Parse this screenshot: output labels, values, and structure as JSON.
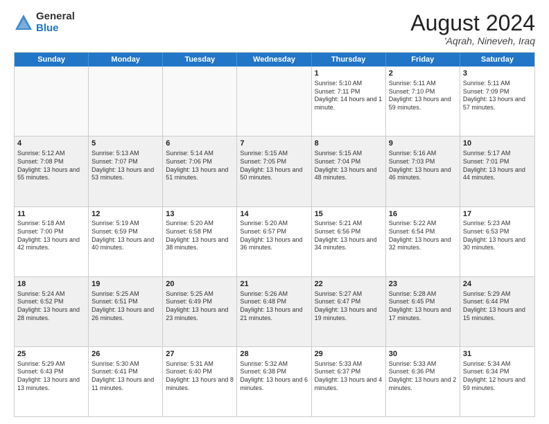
{
  "logo": {
    "general": "General",
    "blue": "Blue"
  },
  "title": {
    "month": "August 2024",
    "location": "'Aqrah, Nineveh, Iraq"
  },
  "header_days": [
    "Sunday",
    "Monday",
    "Tuesday",
    "Wednesday",
    "Thursday",
    "Friday",
    "Saturday"
  ],
  "rows": [
    [
      {
        "day": "",
        "info": "",
        "empty": true
      },
      {
        "day": "",
        "info": "",
        "empty": true
      },
      {
        "day": "",
        "info": "",
        "empty": true
      },
      {
        "day": "",
        "info": "",
        "empty": true
      },
      {
        "day": "1",
        "info": "Sunrise: 5:10 AM\nSunset: 7:11 PM\nDaylight: 14 hours and 1 minute."
      },
      {
        "day": "2",
        "info": "Sunrise: 5:11 AM\nSunset: 7:10 PM\nDaylight: 13 hours and 59 minutes."
      },
      {
        "day": "3",
        "info": "Sunrise: 5:11 AM\nSunset: 7:09 PM\nDaylight: 13 hours and 57 minutes."
      }
    ],
    [
      {
        "day": "4",
        "info": "Sunrise: 5:12 AM\nSunset: 7:08 PM\nDaylight: 13 hours and 55 minutes."
      },
      {
        "day": "5",
        "info": "Sunrise: 5:13 AM\nSunset: 7:07 PM\nDaylight: 13 hours and 53 minutes."
      },
      {
        "day": "6",
        "info": "Sunrise: 5:14 AM\nSunset: 7:06 PM\nDaylight: 13 hours and 51 minutes."
      },
      {
        "day": "7",
        "info": "Sunrise: 5:15 AM\nSunset: 7:05 PM\nDaylight: 13 hours and 50 minutes."
      },
      {
        "day": "8",
        "info": "Sunrise: 5:15 AM\nSunset: 7:04 PM\nDaylight: 13 hours and 48 minutes."
      },
      {
        "day": "9",
        "info": "Sunrise: 5:16 AM\nSunset: 7:03 PM\nDaylight: 13 hours and 46 minutes."
      },
      {
        "day": "10",
        "info": "Sunrise: 5:17 AM\nSunset: 7:01 PM\nDaylight: 13 hours and 44 minutes."
      }
    ],
    [
      {
        "day": "11",
        "info": "Sunrise: 5:18 AM\nSunset: 7:00 PM\nDaylight: 13 hours and 42 minutes."
      },
      {
        "day": "12",
        "info": "Sunrise: 5:19 AM\nSunset: 6:59 PM\nDaylight: 13 hours and 40 minutes."
      },
      {
        "day": "13",
        "info": "Sunrise: 5:20 AM\nSunset: 6:58 PM\nDaylight: 13 hours and 38 minutes."
      },
      {
        "day": "14",
        "info": "Sunrise: 5:20 AM\nSunset: 6:57 PM\nDaylight: 13 hours and 36 minutes."
      },
      {
        "day": "15",
        "info": "Sunrise: 5:21 AM\nSunset: 6:56 PM\nDaylight: 13 hours and 34 minutes."
      },
      {
        "day": "16",
        "info": "Sunrise: 5:22 AM\nSunset: 6:54 PM\nDaylight: 13 hours and 32 minutes."
      },
      {
        "day": "17",
        "info": "Sunrise: 5:23 AM\nSunset: 6:53 PM\nDaylight: 13 hours and 30 minutes."
      }
    ],
    [
      {
        "day": "18",
        "info": "Sunrise: 5:24 AM\nSunset: 6:52 PM\nDaylight: 13 hours and 28 minutes."
      },
      {
        "day": "19",
        "info": "Sunrise: 5:25 AM\nSunset: 6:51 PM\nDaylight: 13 hours and 26 minutes."
      },
      {
        "day": "20",
        "info": "Sunrise: 5:25 AM\nSunset: 6:49 PM\nDaylight: 13 hours and 23 minutes."
      },
      {
        "day": "21",
        "info": "Sunrise: 5:26 AM\nSunset: 6:48 PM\nDaylight: 13 hours and 21 minutes."
      },
      {
        "day": "22",
        "info": "Sunrise: 5:27 AM\nSunset: 6:47 PM\nDaylight: 13 hours and 19 minutes."
      },
      {
        "day": "23",
        "info": "Sunrise: 5:28 AM\nSunset: 6:45 PM\nDaylight: 13 hours and 17 minutes."
      },
      {
        "day": "24",
        "info": "Sunrise: 5:29 AM\nSunset: 6:44 PM\nDaylight: 13 hours and 15 minutes."
      }
    ],
    [
      {
        "day": "25",
        "info": "Sunrise: 5:29 AM\nSunset: 6:43 PM\nDaylight: 13 hours and 13 minutes."
      },
      {
        "day": "26",
        "info": "Sunrise: 5:30 AM\nSunset: 6:41 PM\nDaylight: 13 hours and 11 minutes."
      },
      {
        "day": "27",
        "info": "Sunrise: 5:31 AM\nSunset: 6:40 PM\nDaylight: 13 hours and 8 minutes."
      },
      {
        "day": "28",
        "info": "Sunrise: 5:32 AM\nSunset: 6:38 PM\nDaylight: 13 hours and 6 minutes."
      },
      {
        "day": "29",
        "info": "Sunrise: 5:33 AM\nSunset: 6:37 PM\nDaylight: 13 hours and 4 minutes."
      },
      {
        "day": "30",
        "info": "Sunrise: 5:33 AM\nSunset: 6:36 PM\nDaylight: 13 hours and 2 minutes."
      },
      {
        "day": "31",
        "info": "Sunrise: 5:34 AM\nSunset: 6:34 PM\nDaylight: 12 hours and 59 minutes."
      }
    ]
  ]
}
